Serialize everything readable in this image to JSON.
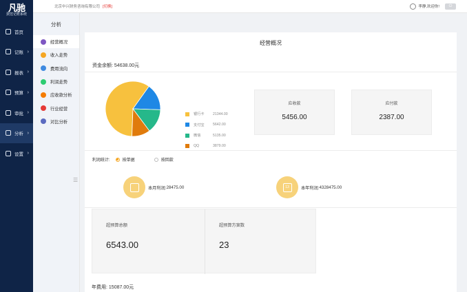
{
  "sidebar": {
    "logo_text": "凡驰",
    "logo_sub": "费控记账系统",
    "items": [
      {
        "label": "首页",
        "icon": "home-icon",
        "has_arrow": false
      },
      {
        "label": "记账",
        "icon": "ledger-icon",
        "has_arrow": true
      },
      {
        "label": "报表",
        "icon": "report-icon",
        "has_arrow": true
      },
      {
        "label": "预算",
        "icon": "budget-icon",
        "has_arrow": true
      },
      {
        "label": "审批",
        "icon": "approval-icon",
        "has_arrow": true
      },
      {
        "label": "分析",
        "icon": "analysis-icon",
        "has_arrow": true,
        "active": true
      },
      {
        "label": "设置",
        "icon": "settings-icon",
        "has_arrow": true
      }
    ]
  },
  "topbar": {
    "company": "北京中兴财务咨询有限公司",
    "switch_label": "[切换]",
    "user_greeting": "李静,欢迎你!",
    "power_icon": "power-icon"
  },
  "submenu": {
    "title": "分析",
    "items": [
      {
        "label": "经营概况",
        "color": "#7e57c2",
        "active": true
      },
      {
        "label": "收入走势",
        "color": "#f5a623"
      },
      {
        "label": "费用流向",
        "color": "#3f8ae0"
      },
      {
        "label": "利润走势",
        "color": "#2ecc71"
      },
      {
        "label": "应收款分析",
        "color": "#f57c00"
      },
      {
        "label": "行业经营",
        "color": "#e53935"
      },
      {
        "label": "对比分析",
        "color": "#5c6bc0"
      }
    ]
  },
  "main": {
    "title": "经营概况",
    "balance_label": "资金余额:",
    "balance_value": "54638.00元",
    "receivable": {
      "label": "应收款",
      "value": "5456.00"
    },
    "payable": {
      "label": "应付款",
      "value": "2387.00"
    },
    "profit_stats_label": "利润统计:",
    "radio_options": [
      {
        "label": "按单据",
        "selected": true
      },
      {
        "label": "按回款",
        "selected": false
      }
    ],
    "month_profit": {
      "label": "本月利润:",
      "value": "28475.00"
    },
    "year_profit": {
      "label": "本年利润:",
      "value": "4328475.00"
    },
    "calendar_badge": "13",
    "over_budget_total": {
      "label": "超预算总额",
      "value": "6543.00"
    },
    "over_budget_plans": {
      "label": "超预算方案数",
      "value": "23"
    },
    "annual_cost_label": "年费用:",
    "annual_cost_value": "15087.00元"
  },
  "chart_data": {
    "type": "pie",
    "categories": [
      "银行卡",
      "支付宝",
      "微信",
      "QQ"
    ],
    "values": [
      21344.0,
      5642.0,
      5135.0,
      3879.0
    ],
    "value_labels": [
      "21344.00",
      "5642.00",
      "5135.00",
      "3879.00"
    ],
    "colors": [
      "#f7c13e",
      "#1e88e5",
      "#26b88a",
      "#e07b0c"
    ],
    "legend_position": "right"
  }
}
